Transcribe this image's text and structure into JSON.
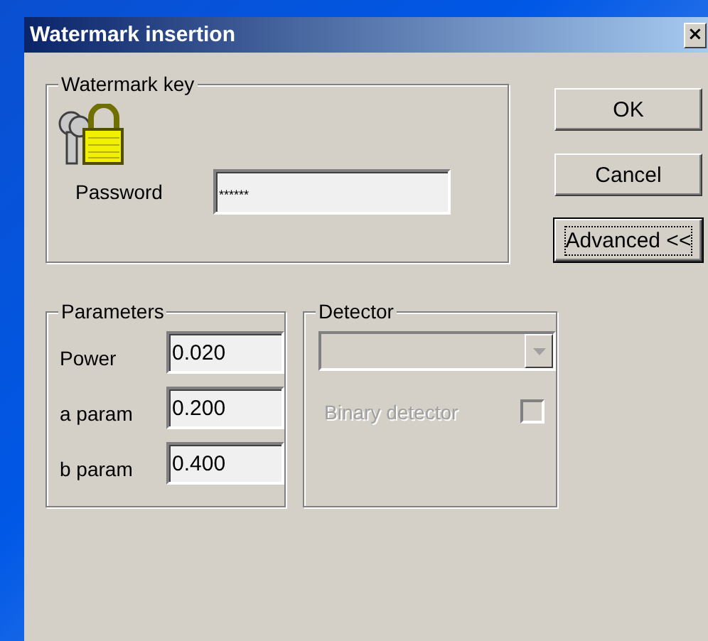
{
  "window": {
    "title": "Watermark insertion",
    "close": "×"
  },
  "watermark_key": {
    "legend": "Watermark key",
    "password": {
      "label": "Password",
      "value": "******"
    }
  },
  "buttons": [
    {
      "label": "OK",
      "focused": false
    },
    {
      "label": "Cancel",
      "focused": false
    },
    {
      "label": "Advanced <<",
      "focused": true
    }
  ],
  "parameters": {
    "legend": "Parameters",
    "fields": [
      {
        "label": "Power",
        "value": "0.020"
      },
      {
        "label": "a param",
        "value": "0.200"
      },
      {
        "label": "b param",
        "value": "0.400"
      }
    ]
  },
  "detector": {
    "legend": "Detector",
    "dropdown": {
      "disabled": true
    },
    "binary_detector": {
      "label": "Binary detector",
      "checked": false,
      "disabled": true
    }
  }
}
